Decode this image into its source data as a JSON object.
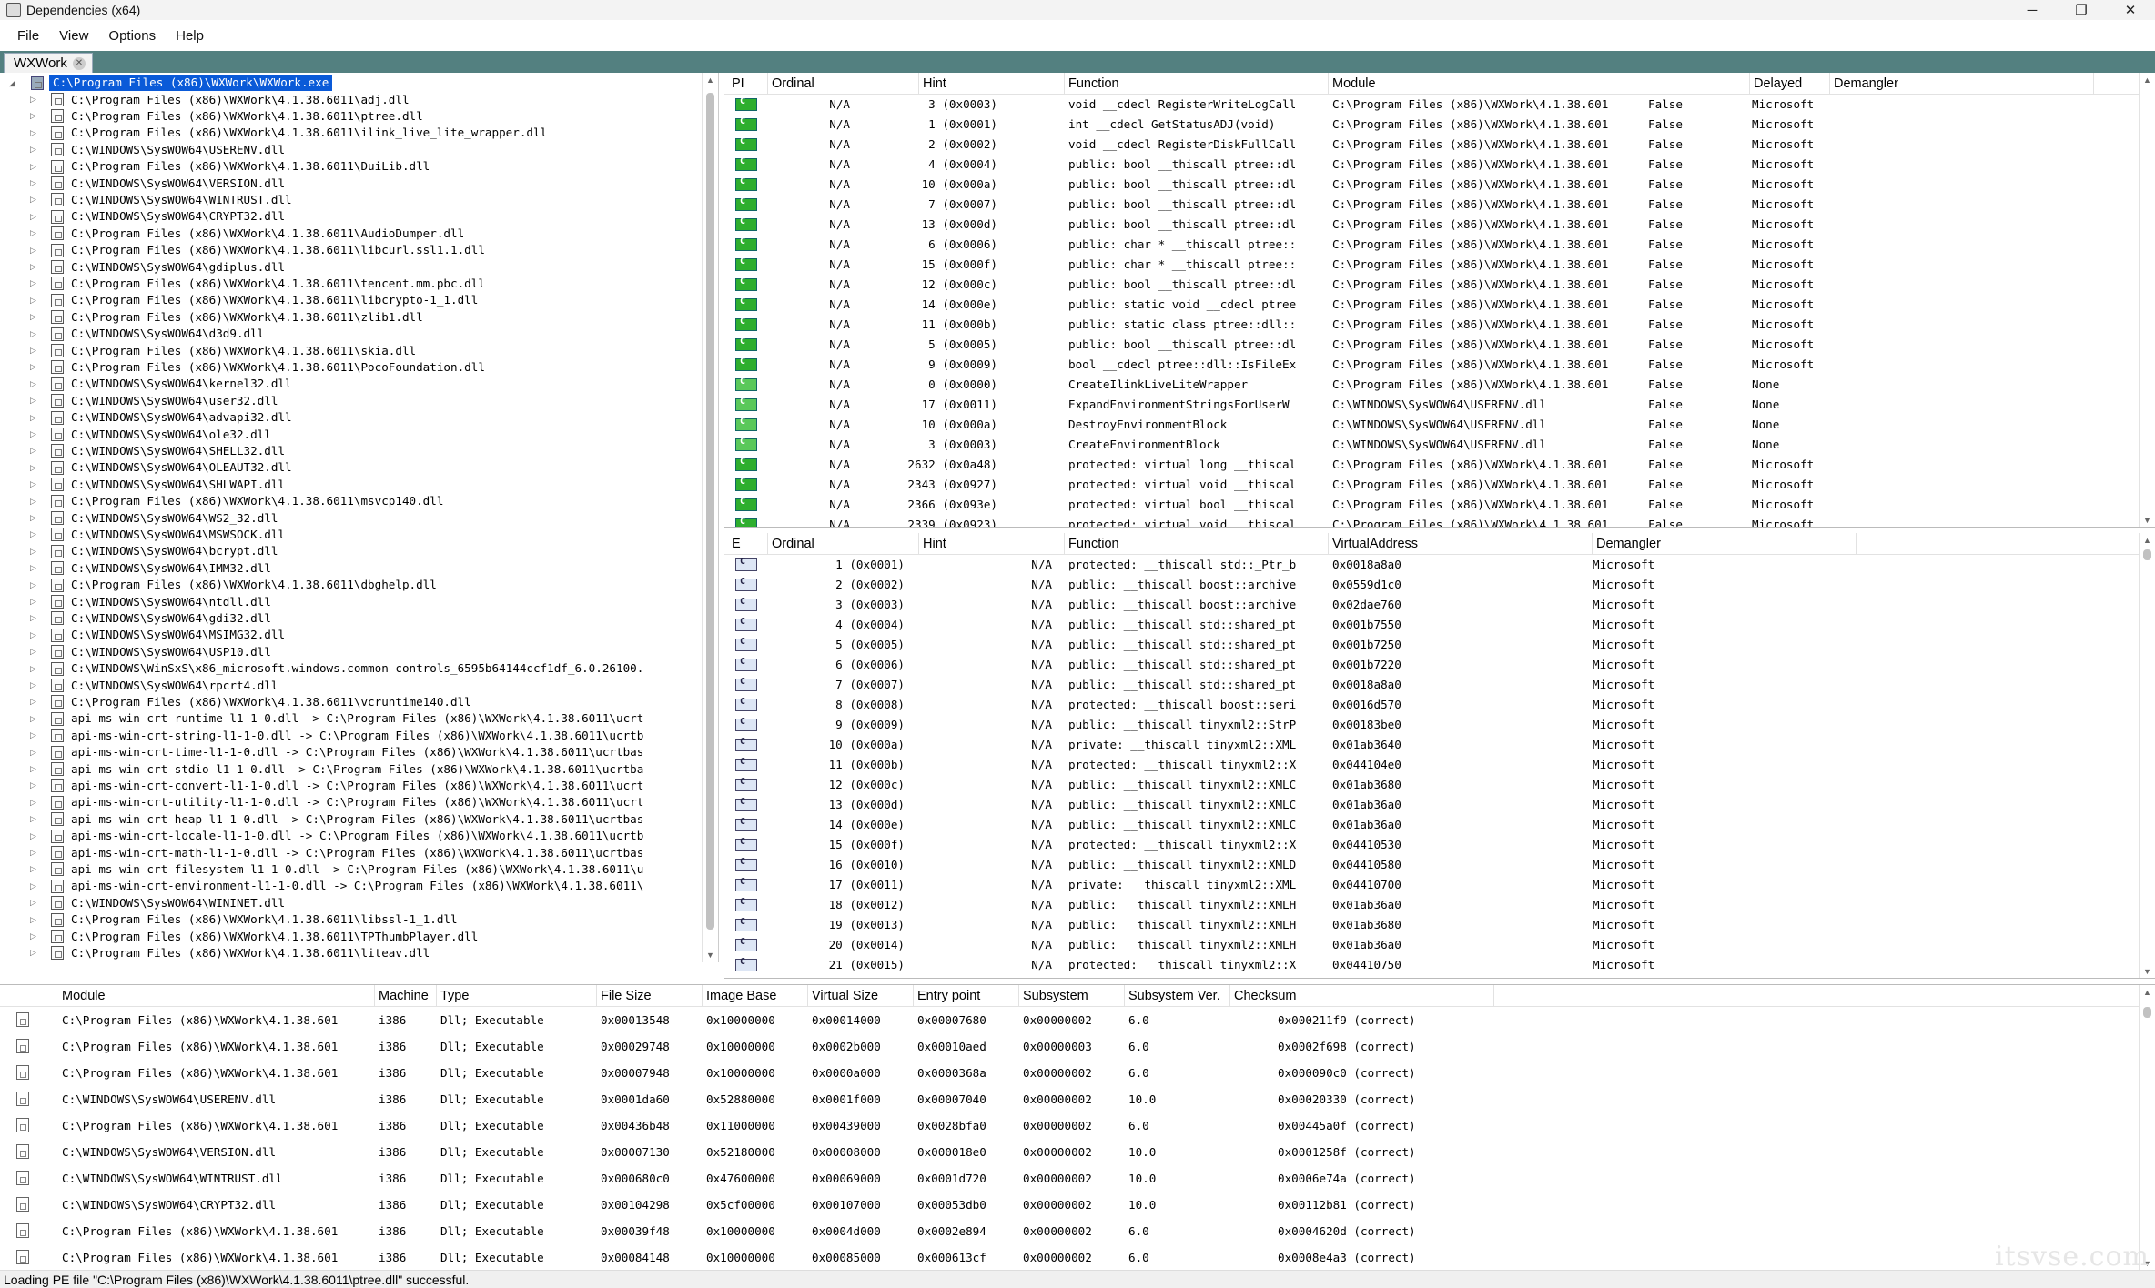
{
  "window": {
    "title": "Dependencies (x64)",
    "controls": {
      "minimize": "─",
      "maximize": "❐",
      "close": "✕"
    }
  },
  "menu": [
    "File",
    "View",
    "Options",
    "Help"
  ],
  "tab": {
    "label": "WXWork",
    "close": "✕"
  },
  "tree": {
    "root": "C:\\Program Files (x86)\\WXWork\\WXWork.exe",
    "items": [
      "C:\\Program Files (x86)\\WXWork\\4.1.38.6011\\adj.dll",
      "C:\\Program Files (x86)\\WXWork\\4.1.38.6011\\ptree.dll",
      "C:\\Program Files (x86)\\WXWork\\4.1.38.6011\\ilink_live_lite_wrapper.dll",
      "C:\\WINDOWS\\SysWOW64\\USERENV.dll",
      "C:\\Program Files (x86)\\WXWork\\4.1.38.6011\\DuiLib.dll",
      "C:\\WINDOWS\\SysWOW64\\VERSION.dll",
      "C:\\WINDOWS\\SysWOW64\\WINTRUST.dll",
      "C:\\WINDOWS\\SysWOW64\\CRYPT32.dll",
      "C:\\Program Files (x86)\\WXWork\\4.1.38.6011\\AudioDumper.dll",
      "C:\\Program Files (x86)\\WXWork\\4.1.38.6011\\libcurl.ssl1.1.dll",
      "C:\\WINDOWS\\SysWOW64\\gdiplus.dll",
      "C:\\Program Files (x86)\\WXWork\\4.1.38.6011\\tencent.mm.pbc.dll",
      "C:\\Program Files (x86)\\WXWork\\4.1.38.6011\\libcrypto-1_1.dll",
      "C:\\Program Files (x86)\\WXWork\\4.1.38.6011\\zlib1.dll",
      "C:\\WINDOWS\\SysWOW64\\d3d9.dll",
      "C:\\Program Files (x86)\\WXWork\\4.1.38.6011\\skia.dll",
      "C:\\Program Files (x86)\\WXWork\\4.1.38.6011\\PocoFoundation.dll",
      "C:\\WINDOWS\\SysWOW64\\kernel32.dll",
      "C:\\WINDOWS\\SysWOW64\\user32.dll",
      "C:\\WINDOWS\\SysWOW64\\advapi32.dll",
      "C:\\WINDOWS\\SysWOW64\\ole32.dll",
      "C:\\WINDOWS\\SysWOW64\\SHELL32.dll",
      "C:\\WINDOWS\\SysWOW64\\OLEAUT32.dll",
      "C:\\WINDOWS\\SysWOW64\\SHLWAPI.dll",
      "C:\\Program Files (x86)\\WXWork\\4.1.38.6011\\msvcp140.dll",
      "C:\\WINDOWS\\SysWOW64\\WS2_32.dll",
      "C:\\WINDOWS\\SysWOW64\\MSWSOCK.dll",
      "C:\\WINDOWS\\SysWOW64\\bcrypt.dll",
      "C:\\WINDOWS\\SysWOW64\\IMM32.dll",
      "C:\\Program Files (x86)\\WXWork\\4.1.38.6011\\dbghelp.dll",
      "C:\\WINDOWS\\SysWOW64\\ntdll.dll",
      "C:\\WINDOWS\\SysWOW64\\gdi32.dll",
      "C:\\WINDOWS\\SysWOW64\\MSIMG32.dll",
      "C:\\WINDOWS\\SysWOW64\\USP10.dll",
      "C:\\WINDOWS\\WinSxS\\x86_microsoft.windows.common-controls_6595b64144ccf1df_6.0.26100.",
      "C:\\WINDOWS\\SysWOW64\\rpcrt4.dll",
      "C:\\Program Files (x86)\\WXWork\\4.1.38.6011\\vcruntime140.dll",
      "api-ms-win-crt-runtime-l1-1-0.dll -> C:\\Program Files (x86)\\WXWork\\4.1.38.6011\\ucrt",
      "api-ms-win-crt-string-l1-1-0.dll -> C:\\Program Files (x86)\\WXWork\\4.1.38.6011\\ucrtb",
      "api-ms-win-crt-time-l1-1-0.dll -> C:\\Program Files (x86)\\WXWork\\4.1.38.6011\\ucrtbas",
      "api-ms-win-crt-stdio-l1-1-0.dll -> C:\\Program Files (x86)\\WXWork\\4.1.38.6011\\ucrtba",
      "api-ms-win-crt-convert-l1-1-0.dll -> C:\\Program Files (x86)\\WXWork\\4.1.38.6011\\ucrt",
      "api-ms-win-crt-utility-l1-1-0.dll -> C:\\Program Files (x86)\\WXWork\\4.1.38.6011\\ucrt",
      "api-ms-win-crt-heap-l1-1-0.dll -> C:\\Program Files (x86)\\WXWork\\4.1.38.6011\\ucrtbas",
      "api-ms-win-crt-locale-l1-1-0.dll -> C:\\Program Files (x86)\\WXWork\\4.1.38.6011\\ucrtb",
      "api-ms-win-crt-math-l1-1-0.dll -> C:\\Program Files (x86)\\WXWork\\4.1.38.6011\\ucrtbas",
      "api-ms-win-crt-filesystem-l1-1-0.dll -> C:\\Program Files (x86)\\WXWork\\4.1.38.6011\\u",
      "api-ms-win-crt-environment-l1-1-0.dll -> C:\\Program Files (x86)\\WXWork\\4.1.38.6011\\",
      "C:\\WINDOWS\\SysWOW64\\WININET.dll",
      "C:\\Program Files (x86)\\WXWork\\4.1.38.6011\\libssl-1_1.dll",
      "C:\\Program Files (x86)\\WXWork\\4.1.38.6011\\TPThumbPlayer.dll",
      "C:\\Program Files (x86)\\WXWork\\4.1.38.6011\\liteav.dll"
    ]
  },
  "imports": {
    "headers": [
      "PI",
      "Ordinal",
      "Hint",
      "Function",
      "Module",
      "Delayed",
      "Demangler"
    ],
    "rows": [
      {
        "ordinal": "N/A",
        "hint": "3 (0x0003)",
        "function": "void __cdecl RegisterWriteLogCall",
        "module": "C:\\Program Files (x86)\\WXWork\\4.1.38.601",
        "delayed": "False",
        "demangler": "Microsoft",
        "icon": "cpp"
      },
      {
        "ordinal": "N/A",
        "hint": "1 (0x0001)",
        "function": "int __cdecl GetStatusADJ(void)",
        "module": "C:\\Program Files (x86)\\WXWork\\4.1.38.601",
        "delayed": "False",
        "demangler": "Microsoft",
        "icon": "cpp"
      },
      {
        "ordinal": "N/A",
        "hint": "2 (0x0002)",
        "function": "void __cdecl RegisterDiskFullCall",
        "module": "C:\\Program Files (x86)\\WXWork\\4.1.38.601",
        "delayed": "False",
        "demangler": "Microsoft",
        "icon": "cpp"
      },
      {
        "ordinal": "N/A",
        "hint": "4 (0x0004)",
        "function": "public: bool __thiscall ptree::dl",
        "module": "C:\\Program Files (x86)\\WXWork\\4.1.38.601",
        "delayed": "False",
        "demangler": "Microsoft",
        "icon": "cpp"
      },
      {
        "ordinal": "N/A",
        "hint": "10 (0x000a)",
        "function": "public: bool __thiscall ptree::dl",
        "module": "C:\\Program Files (x86)\\WXWork\\4.1.38.601",
        "delayed": "False",
        "demangler": "Microsoft",
        "icon": "cpp"
      },
      {
        "ordinal": "N/A",
        "hint": "7 (0x0007)",
        "function": "public: bool __thiscall ptree::dl",
        "module": "C:\\Program Files (x86)\\WXWork\\4.1.38.601",
        "delayed": "False",
        "demangler": "Microsoft",
        "icon": "cpp"
      },
      {
        "ordinal": "N/A",
        "hint": "13 (0x000d)",
        "function": "public: bool __thiscall ptree::dl",
        "module": "C:\\Program Files (x86)\\WXWork\\4.1.38.601",
        "delayed": "False",
        "demangler": "Microsoft",
        "icon": "cpp"
      },
      {
        "ordinal": "N/A",
        "hint": "6 (0x0006)",
        "function": "public: char * __thiscall ptree::",
        "module": "C:\\Program Files (x86)\\WXWork\\4.1.38.601",
        "delayed": "False",
        "demangler": "Microsoft",
        "icon": "cpp"
      },
      {
        "ordinal": "N/A",
        "hint": "15 (0x000f)",
        "function": "public: char * __thiscall ptree::",
        "module": "C:\\Program Files (x86)\\WXWork\\4.1.38.601",
        "delayed": "False",
        "demangler": "Microsoft",
        "icon": "cpp"
      },
      {
        "ordinal": "N/A",
        "hint": "12 (0x000c)",
        "function": "public: bool __thiscall ptree::dl",
        "module": "C:\\Program Files (x86)\\WXWork\\4.1.38.601",
        "delayed": "False",
        "demangler": "Microsoft",
        "icon": "cpp"
      },
      {
        "ordinal": "N/A",
        "hint": "14 (0x000e)",
        "function": "public: static void __cdecl ptree",
        "module": "C:\\Program Files (x86)\\WXWork\\4.1.38.601",
        "delayed": "False",
        "demangler": "Microsoft",
        "icon": "cpp"
      },
      {
        "ordinal": "N/A",
        "hint": "11 (0x000b)",
        "function": "public: static class ptree::dll::",
        "module": "C:\\Program Files (x86)\\WXWork\\4.1.38.601",
        "delayed": "False",
        "demangler": "Microsoft",
        "icon": "cpp"
      },
      {
        "ordinal": "N/A",
        "hint": "5 (0x0005)",
        "function": "public: bool __thiscall ptree::dl",
        "module": "C:\\Program Files (x86)\\WXWork\\4.1.38.601",
        "delayed": "False",
        "demangler": "Microsoft",
        "icon": "cpp"
      },
      {
        "ordinal": "N/A",
        "hint": "9 (0x0009)",
        "function": "bool __cdecl ptree::dll::IsFileEx",
        "module": "C:\\Program Files (x86)\\WXWork\\4.1.38.601",
        "delayed": "False",
        "demangler": "Microsoft",
        "icon": "cpp"
      },
      {
        "ordinal": "N/A",
        "hint": "0 (0x0000)",
        "function": "CreateIlinkLiveLiteWrapper",
        "module": "C:\\Program Files (x86)\\WXWork\\4.1.38.601",
        "delayed": "False",
        "demangler": "None",
        "icon": "c"
      },
      {
        "ordinal": "N/A",
        "hint": "17 (0x0011)",
        "function": "ExpandEnvironmentStringsForUserW",
        "module": "C:\\WINDOWS\\SysWOW64\\USERENV.dll",
        "delayed": "False",
        "demangler": "None",
        "icon": "c"
      },
      {
        "ordinal": "N/A",
        "hint": "10 (0x000a)",
        "function": "DestroyEnvironmentBlock",
        "module": "C:\\WINDOWS\\SysWOW64\\USERENV.dll",
        "delayed": "False",
        "demangler": "None",
        "icon": "c"
      },
      {
        "ordinal": "N/A",
        "hint": "3 (0x0003)",
        "function": "CreateEnvironmentBlock",
        "module": "C:\\WINDOWS\\SysWOW64\\USERENV.dll",
        "delayed": "False",
        "demangler": "None",
        "icon": "c"
      },
      {
        "ordinal": "N/A",
        "hint": "2632 (0x0a48)",
        "function": "protected: virtual long __thiscal",
        "module": "C:\\Program Files (x86)\\WXWork\\4.1.38.601",
        "delayed": "False",
        "demangler": "Microsoft",
        "icon": "cpp"
      },
      {
        "ordinal": "N/A",
        "hint": "2343 (0x0927)",
        "function": "protected: virtual void __thiscal",
        "module": "C:\\Program Files (x86)\\WXWork\\4.1.38.601",
        "delayed": "False",
        "demangler": "Microsoft",
        "icon": "cpp"
      },
      {
        "ordinal": "N/A",
        "hint": "2366 (0x093e)",
        "function": "protected: virtual bool __thiscal",
        "module": "C:\\Program Files (x86)\\WXWork\\4.1.38.601",
        "delayed": "False",
        "demangler": "Microsoft",
        "icon": "cpp"
      },
      {
        "ordinal": "N/A",
        "hint": "2339 (0x0923)",
        "function": "protected: virtual void __thiscal",
        "module": "C:\\Program Files (x86)\\WXWork\\4.1.38.601",
        "delayed": "False",
        "demangler": "Microsoft",
        "icon": "cpp"
      }
    ]
  },
  "exports": {
    "headers": [
      "E",
      "Ordinal",
      "Hint",
      "Function",
      "VirtualAddress",
      "Demangler"
    ],
    "rows": [
      {
        "ordinal": "1 (0x0001)",
        "hint": "N/A",
        "function": "protected: __thiscall std::_Ptr_b",
        "address": "0x0018a8a0",
        "demangler": "Microsoft"
      },
      {
        "ordinal": "2 (0x0002)",
        "hint": "N/A",
        "function": "public: __thiscall boost::archive",
        "address": "0x0559d1c0",
        "demangler": "Microsoft"
      },
      {
        "ordinal": "3 (0x0003)",
        "hint": "N/A",
        "function": "public: __thiscall boost::archive",
        "address": "0x02dae760",
        "demangler": "Microsoft"
      },
      {
        "ordinal": "4 (0x0004)",
        "hint": "N/A",
        "function": "public: __thiscall std::shared_pt",
        "address": "0x001b7550",
        "demangler": "Microsoft"
      },
      {
        "ordinal": "5 (0x0005)",
        "hint": "N/A",
        "function": "public: __thiscall std::shared_pt",
        "address": "0x001b7250",
        "demangler": "Microsoft"
      },
      {
        "ordinal": "6 (0x0006)",
        "hint": "N/A",
        "function": "public: __thiscall std::shared_pt",
        "address": "0x001b7220",
        "demangler": "Microsoft"
      },
      {
        "ordinal": "7 (0x0007)",
        "hint": "N/A",
        "function": "public: __thiscall std::shared_pt",
        "address": "0x0018a8a0",
        "demangler": "Microsoft"
      },
      {
        "ordinal": "8 (0x0008)",
        "hint": "N/A",
        "function": "protected: __thiscall boost::seri",
        "address": "0x0016d570",
        "demangler": "Microsoft"
      },
      {
        "ordinal": "9 (0x0009)",
        "hint": "N/A",
        "function": "public: __thiscall tinyxml2::StrP",
        "address": "0x00183be0",
        "demangler": "Microsoft"
      },
      {
        "ordinal": "10 (0x000a)",
        "hint": "N/A",
        "function": "private: __thiscall tinyxml2::XML",
        "address": "0x01ab3640",
        "demangler": "Microsoft"
      },
      {
        "ordinal": "11 (0x000b)",
        "hint": "N/A",
        "function": "protected: __thiscall tinyxml2::X",
        "address": "0x044104e0",
        "demangler": "Microsoft"
      },
      {
        "ordinal": "12 (0x000c)",
        "hint": "N/A",
        "function": "public: __thiscall tinyxml2::XMLC",
        "address": "0x01ab3680",
        "demangler": "Microsoft"
      },
      {
        "ordinal": "13 (0x000d)",
        "hint": "N/A",
        "function": "public: __thiscall tinyxml2::XMLC",
        "address": "0x01ab36a0",
        "demangler": "Microsoft"
      },
      {
        "ordinal": "14 (0x000e)",
        "hint": "N/A",
        "function": "public: __thiscall tinyxml2::XMLC",
        "address": "0x01ab36a0",
        "demangler": "Microsoft"
      },
      {
        "ordinal": "15 (0x000f)",
        "hint": "N/A",
        "function": "protected: __thiscall tinyxml2::X",
        "address": "0x04410530",
        "demangler": "Microsoft"
      },
      {
        "ordinal": "16 (0x0010)",
        "hint": "N/A",
        "function": "public: __thiscall tinyxml2::XMLD",
        "address": "0x04410580",
        "demangler": "Microsoft"
      },
      {
        "ordinal": "17 (0x0011)",
        "hint": "N/A",
        "function": "private: __thiscall tinyxml2::XML",
        "address": "0x04410700",
        "demangler": "Microsoft"
      },
      {
        "ordinal": "18 (0x0012)",
        "hint": "N/A",
        "function": "public: __thiscall tinyxml2::XMLH",
        "address": "0x01ab36a0",
        "demangler": "Microsoft"
      },
      {
        "ordinal": "19 (0x0013)",
        "hint": "N/A",
        "function": "public: __thiscall tinyxml2::XMLH",
        "address": "0x01ab3680",
        "demangler": "Microsoft"
      },
      {
        "ordinal": "20 (0x0014)",
        "hint": "N/A",
        "function": "public: __thiscall tinyxml2::XMLH",
        "address": "0x01ab36a0",
        "demangler": "Microsoft"
      },
      {
        "ordinal": "21 (0x0015)",
        "hint": "N/A",
        "function": "protected: __thiscall tinyxml2::X",
        "address": "0x04410750",
        "demangler": "Microsoft"
      }
    ]
  },
  "modules": {
    "headers": [
      "Module",
      "Machine",
      "Type",
      "File Size",
      "Image Base",
      "Virtual Size",
      "Entry point",
      "Subsystem",
      "Subsystem Ver.",
      "Checksum"
    ],
    "rows": [
      {
        "module": "C:\\Program Files (x86)\\WXWork\\4.1.38.601",
        "machine": "i386",
        "type": "Dll; Executable",
        "file_size": "0x00013548",
        "image_base": "0x10000000",
        "virtual_size": "0x00014000",
        "entry": "0x00007680",
        "subsystem": "0x00000002",
        "subver": "6.0",
        "checksum": "0x000211f9 (correct)"
      },
      {
        "module": "C:\\Program Files (x86)\\WXWork\\4.1.38.601",
        "machine": "i386",
        "type": "Dll; Executable",
        "file_size": "0x00029748",
        "image_base": "0x10000000",
        "virtual_size": "0x0002b000",
        "entry": "0x00010aed",
        "subsystem": "0x00000003",
        "subver": "6.0",
        "checksum": "0x0002f698 (correct)"
      },
      {
        "module": "C:\\Program Files (x86)\\WXWork\\4.1.38.601",
        "machine": "i386",
        "type": "Dll; Executable",
        "file_size": "0x00007948",
        "image_base": "0x10000000",
        "virtual_size": "0x0000a000",
        "entry": "0x0000368a",
        "subsystem": "0x00000002",
        "subver": "6.0",
        "checksum": "0x000090c0 (correct)"
      },
      {
        "module": "C:\\WINDOWS\\SysWOW64\\USERENV.dll",
        "machine": "i386",
        "type": "Dll; Executable",
        "file_size": "0x0001da60",
        "image_base": "0x52880000",
        "virtual_size": "0x0001f000",
        "entry": "0x00007040",
        "subsystem": "0x00000002",
        "subver": "10.0",
        "checksum": "0x00020330 (correct)"
      },
      {
        "module": "C:\\Program Files (x86)\\WXWork\\4.1.38.601",
        "machine": "i386",
        "type": "Dll; Executable",
        "file_size": "0x00436b48",
        "image_base": "0x11000000",
        "virtual_size": "0x00439000",
        "entry": "0x0028bfa0",
        "subsystem": "0x00000002",
        "subver": "6.0",
        "checksum": "0x00445a0f (correct)"
      },
      {
        "module": "C:\\WINDOWS\\SysWOW64\\VERSION.dll",
        "machine": "i386",
        "type": "Dll; Executable",
        "file_size": "0x00007130",
        "image_base": "0x52180000",
        "virtual_size": "0x00008000",
        "entry": "0x000018e0",
        "subsystem": "0x00000002",
        "subver": "10.0",
        "checksum": "0x0001258f (correct)"
      },
      {
        "module": "C:\\WINDOWS\\SysWOW64\\WINTRUST.dll",
        "machine": "i386",
        "type": "Dll; Executable",
        "file_size": "0x000680c0",
        "image_base": "0x47600000",
        "virtual_size": "0x00069000",
        "entry": "0x0001d720",
        "subsystem": "0x00000002",
        "subver": "10.0",
        "checksum": "0x0006e74a (correct)"
      },
      {
        "module": "C:\\WINDOWS\\SysWOW64\\CRYPT32.dll",
        "machine": "i386",
        "type": "Dll; Executable",
        "file_size": "0x00104298",
        "image_base": "0x5cf00000",
        "virtual_size": "0x00107000",
        "entry": "0x00053db0",
        "subsystem": "0x00000002",
        "subver": "10.0",
        "checksum": "0x00112b81 (correct)"
      },
      {
        "module": "C:\\Program Files (x86)\\WXWork\\4.1.38.601",
        "machine": "i386",
        "type": "Dll; Executable",
        "file_size": "0x00039f48",
        "image_base": "0x10000000",
        "virtual_size": "0x0004d000",
        "entry": "0x0002e894",
        "subsystem": "0x00000002",
        "subver": "6.0",
        "checksum": "0x0004620d (correct)"
      },
      {
        "module": "C:\\Program Files (x86)\\WXWork\\4.1.38.601",
        "machine": "i386",
        "type": "Dll; Executable",
        "file_size": "0x00084148",
        "image_base": "0x10000000",
        "virtual_size": "0x00085000",
        "entry": "0x000613cf",
        "subsystem": "0x00000002",
        "subver": "6.0",
        "checksum": "0x0008e4a3 (correct)"
      }
    ]
  },
  "status": "Loading PE file \"C:\\Program Files (x86)\\WXWork\\4.1.38.6011\\ptree.dll\" successful.",
  "watermark": "itsvse.com"
}
